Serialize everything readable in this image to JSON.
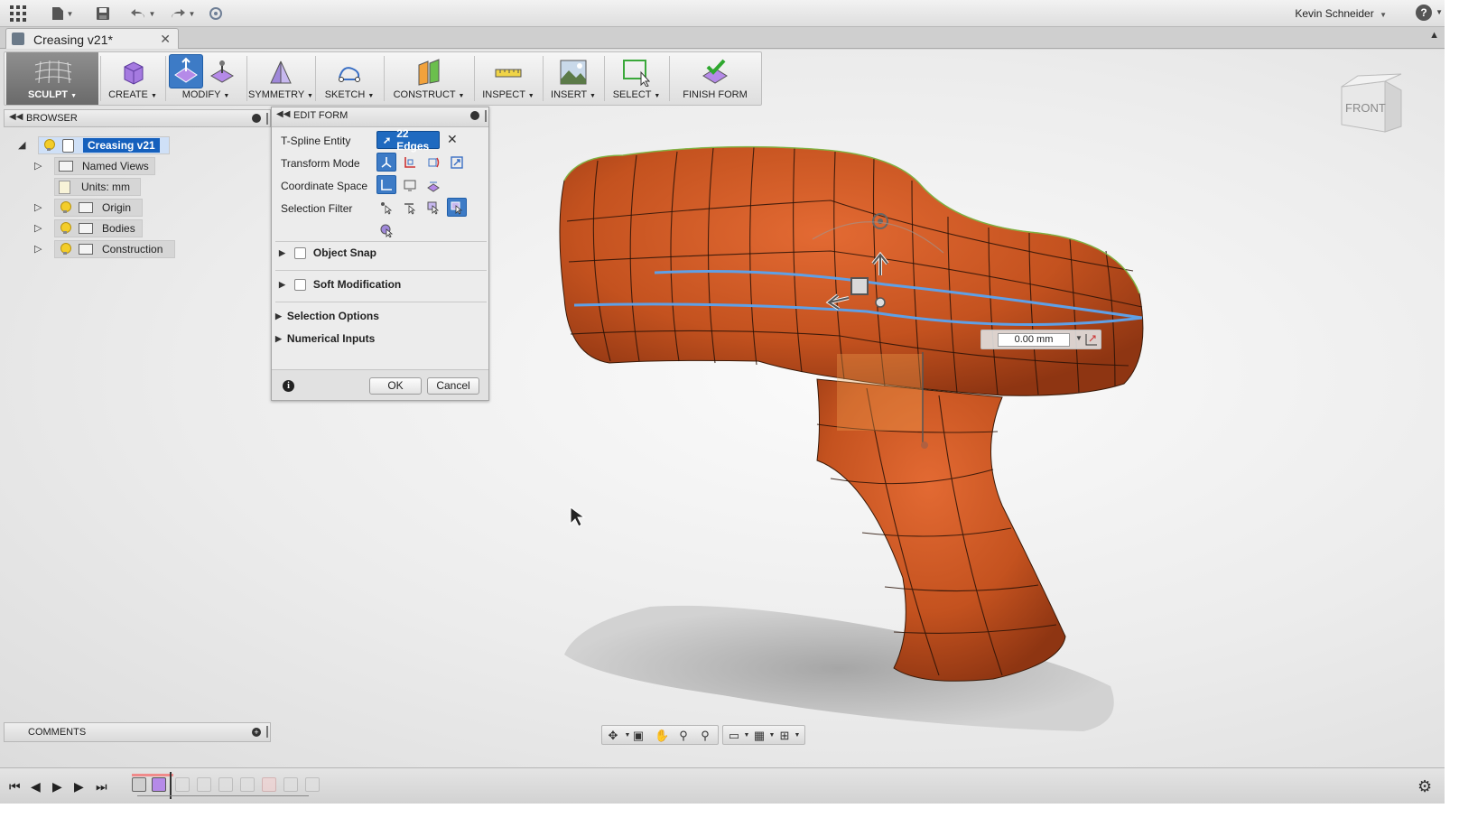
{
  "app": {
    "user_name": "Kevin Schneider"
  },
  "document": {
    "tab_title": "Creasing v21*"
  },
  "ribbon": {
    "groups": [
      {
        "label": "SCULPT"
      },
      {
        "label": "CREATE"
      },
      {
        "label": "MODIFY"
      },
      {
        "label": "SYMMETRY"
      },
      {
        "label": "SKETCH"
      },
      {
        "label": "CONSTRUCT"
      },
      {
        "label": "INSPECT"
      },
      {
        "label": "INSERT"
      },
      {
        "label": "SELECT"
      },
      {
        "label": "FINISH FORM"
      }
    ],
    "colors": {
      "accent": "#3d7bc6",
      "sculpt_bg": "#7a7a7a"
    }
  },
  "browser": {
    "title": "BROWSER",
    "root": "Creasing v21",
    "items": [
      {
        "label": "Named Views",
        "icon": "folder-icon"
      },
      {
        "label": "Units: mm",
        "icon": "units-icon"
      },
      {
        "label": "Origin",
        "icon": "folder-icon"
      },
      {
        "label": "Bodies",
        "icon": "folder-icon"
      },
      {
        "label": "Construction",
        "icon": "folder-icon"
      }
    ]
  },
  "edit_form": {
    "title": "EDIT FORM",
    "rows": {
      "tspline_entity": "T-Spline Entity",
      "transform_mode": "Transform Mode",
      "coordinate_space": "Coordinate Space",
      "selection_filter": "Selection Filter"
    },
    "selection_value": "22 Edges",
    "expanders": {
      "object_snap": "Object Snap",
      "soft_modification": "Soft Modification",
      "selection_options": "Selection Options",
      "numerical_inputs": "Numerical Inputs"
    },
    "ok_label": "OK",
    "cancel_label": "Cancel"
  },
  "manipulator": {
    "distance_value": "0.00 mm"
  },
  "viewcube": {
    "face_label": "FRONT"
  },
  "comments": {
    "title": "COMMENTS"
  },
  "model": {
    "body_color": "#c4521f",
    "edge_highlight": "#5fa0e6"
  }
}
